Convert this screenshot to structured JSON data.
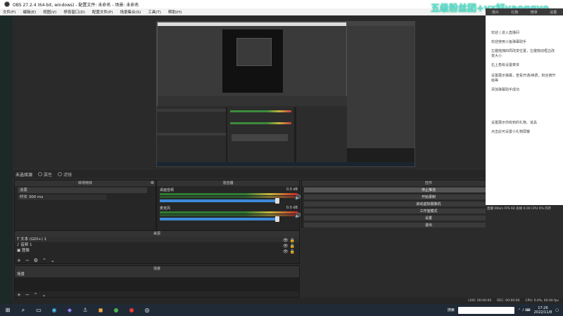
{
  "window": {
    "title": "OBS 27.2.4 (64-bit, windows) - 配置文件: 未命名 - 场景: 未命名"
  },
  "menu": [
    "文件(F)",
    "编辑(E)",
    "视图(V)",
    "停靠窗口(D)",
    "配置文件(P)",
    "场景集合(S)",
    "工具(T)",
    "帮助(H)"
  ],
  "watermark": "五级粉丝团+vx好yaoggyo",
  "preview_inner": {
    "label_a": "场景转场",
    "label_b": "混音器"
  },
  "scene_strip": {
    "label": "未选择源",
    "btn_props": "属性",
    "btn_filters": "滤镜"
  },
  "scenes_dock": {
    "title": "转场特效",
    "items": [
      "淡变",
      "时长   300 ms"
    ]
  },
  "mixer_dock": {
    "title": "混音器",
    "tracks": [
      {
        "name": "桌面音频",
        "db": "0.0 dB",
        "level": 0.9
      },
      {
        "name": "麦克风",
        "db": "0.0 dB",
        "level": 0.9
      }
    ]
  },
  "controls_dock": {
    "title": "控件",
    "buttons": [
      "停止推流",
      "开始录制",
      "启动虚拟摄像机",
      "工作室模式",
      "设置",
      "退出"
    ]
  },
  "sources_dock": {
    "title": "来源",
    "items": [
      "文本 (GDI+) 1",
      "音频 1",
      "图像",
      "显示器采集"
    ]
  },
  "scenes_list_dock": {
    "title": "场景",
    "items": [
      "场景"
    ]
  },
  "chat": {
    "header": [
      "观众",
      "礼物",
      "榜单",
      "设置"
    ],
    "lines": [
      "欢迎 | 进入直播间",
      "欢迎使用斗鱼弹幕助手",
      "左键拖拽四周改变位置，左键拖动框边改变大小",
      "右上角有设置菜单",
      "设置展示弹幕，查看开通/续费，粉丝牌升级等",
      "添加弹幕助手成功",
      "设置展示你收到的礼物、道具",
      "点击此可设置小礼物屏蔽"
    ],
    "status": "直播 0Kb/s FPS 60 丢帧 0.00 CPU 0% 内存"
  },
  "statusbar": {
    "items": [
      "LIVE: 00:00:00",
      "REC: 00:00:00",
      "CPU: 0.0%, 60.00 fps"
    ]
  },
  "taskbar": {
    "search_placeholder": "搜索",
    "time": "17:26",
    "date": "2022/11/8"
  }
}
